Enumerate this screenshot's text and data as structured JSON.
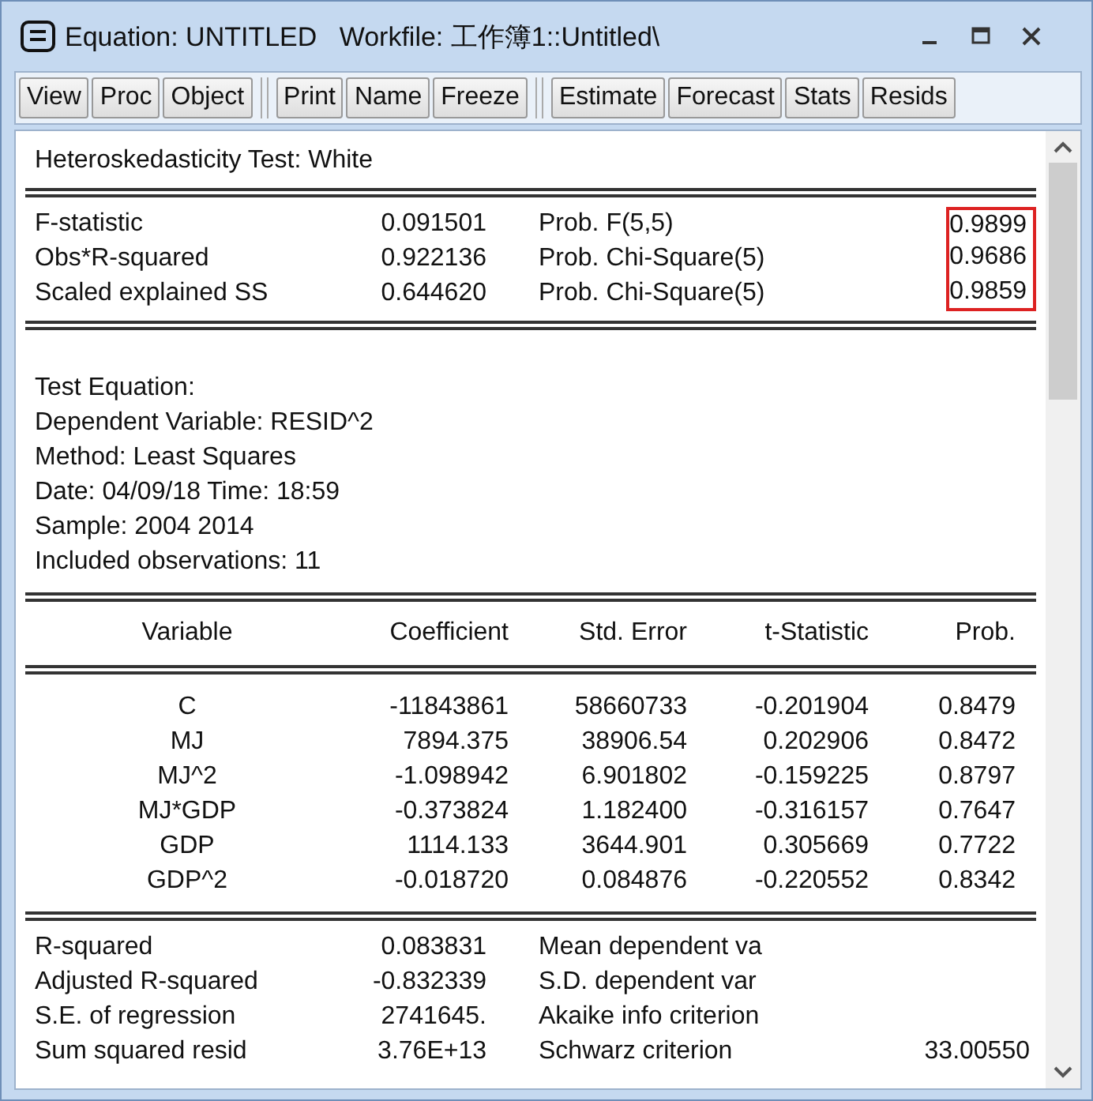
{
  "window": {
    "title": "Equation: UNTITLED   Workfile: 工作簿1::Untitled\\"
  },
  "toolbar": [
    [
      "View",
      "Proc",
      "Object"
    ],
    [
      "Print",
      "Name",
      "Freeze"
    ],
    [
      "Estimate",
      "Forecast",
      "Stats",
      "Resids"
    ]
  ],
  "test": {
    "title": "Heteroskedasticity Test: White",
    "prob_highlight": true,
    "stats": [
      {
        "label": "F-statistic",
        "value": "0.091501",
        "prob_label": "Prob. F(5,5)",
        "prob": "0.9899"
      },
      {
        "label": "Obs*R-squared",
        "value": "0.922136",
        "prob_label": "Prob. Chi-Square(5)",
        "prob": "0.9686"
      },
      {
        "label": "Scaled explained SS",
        "value": "0.644620",
        "prob_label": "Prob. Chi-Square(5)",
        "prob": "0.9859"
      }
    ]
  },
  "equation_info": [
    "Test Equation:",
    "Dependent Variable: RESID^2",
    "Method: Least Squares",
    "Date: 04/09/18   Time: 18:59",
    "Sample: 2004 2014",
    "Included observations: 11"
  ],
  "coefficients": {
    "columns": [
      "Variable",
      "Coefficient",
      "Std. Error",
      "t-Statistic",
      "Prob."
    ],
    "rows": [
      [
        "C",
        "-11843861",
        "58660733",
        "-0.201904",
        "0.8479"
      ],
      [
        "MJ",
        "7894.375",
        "38906.54",
        "0.202906",
        "0.8472"
      ],
      [
        "MJ^2",
        "-1.098942",
        "6.901802",
        "-0.159225",
        "0.8797"
      ],
      [
        "MJ*GDP",
        "-0.373824",
        "1.182400",
        "-0.316157",
        "0.7647"
      ],
      [
        "GDP",
        "1114.133",
        "3644.901",
        "0.305669",
        "0.7722"
      ],
      [
        "GDP^2",
        "-0.018720",
        "0.084876",
        "-0.220552",
        "0.8342"
      ]
    ]
  },
  "summary": [
    {
      "label": "R-squared",
      "value": "0.083831",
      "label_2": "Mean dependent va"
    },
    {
      "label": "Adjusted R-squared",
      "value": "-0.832339",
      "label_2": "S.D. dependent var"
    },
    {
      "label": "S.E. of regression",
      "value": "2741645.",
      "label_2": "Akaike info criterion"
    },
    {
      "label": "Sum squared resid",
      "value": "3.76E+13",
      "label_2": "Schwarz criterion",
      "value_2": "33.00550"
    }
  ]
}
